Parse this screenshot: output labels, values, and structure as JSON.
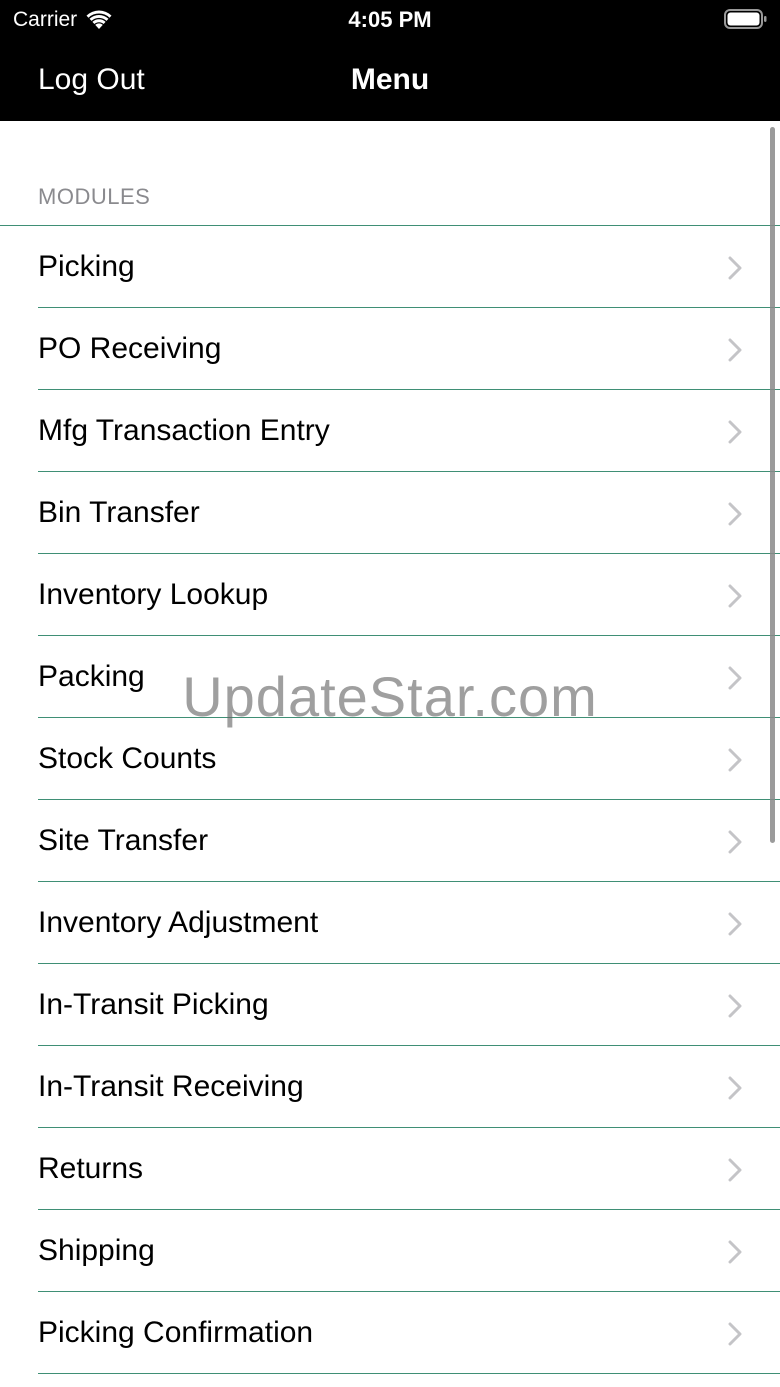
{
  "status_bar": {
    "carrier": "Carrier",
    "time": "4:05 PM",
    "icons": [
      "wifi-icon",
      "battery-icon"
    ]
  },
  "nav_bar": {
    "left_button": "Log Out",
    "title": "Menu"
  },
  "section": {
    "header": "MODULES",
    "items": [
      {
        "label": "Picking"
      },
      {
        "label": "PO Receiving"
      },
      {
        "label": "Mfg Transaction Entry"
      },
      {
        "label": "Bin Transfer"
      },
      {
        "label": "Inventory Lookup"
      },
      {
        "label": "Packing"
      },
      {
        "label": "Stock Counts"
      },
      {
        "label": "Site Transfer"
      },
      {
        "label": "Inventory Adjustment"
      },
      {
        "label": "In-Transit Picking"
      },
      {
        "label": "In-Transit Receiving"
      },
      {
        "label": "Returns"
      },
      {
        "label": "Shipping"
      },
      {
        "label": "Picking Confirmation"
      }
    ]
  },
  "watermark": "UpdateStar.com",
  "colors": {
    "nav_background": "#000000",
    "separator": "#3f8f75",
    "section_header": "#8a8a8e",
    "chevron": "#c4c4c7"
  }
}
